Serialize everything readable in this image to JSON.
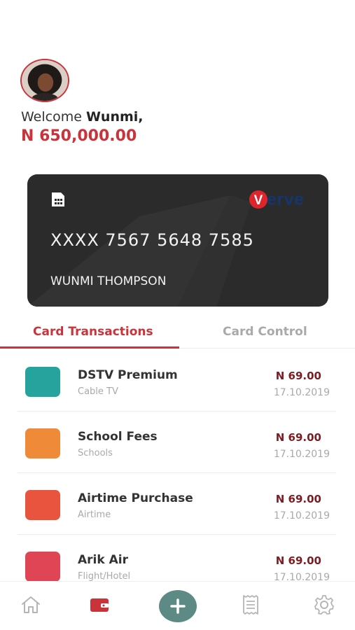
{
  "profile": {
    "avatar_icon": "user-avatar-photo",
    "welcome_prefix": "Welcome",
    "user_name": "Wunmi,",
    "balance": "N 650,000.00"
  },
  "card": {
    "chip_icon": "sim-chip-icon",
    "brand_mark": "V",
    "brand_text": "erve",
    "number": "XXXX 7567 5648 7585",
    "holder": "WUNMI THOMPSON"
  },
  "tabs": {
    "active": "Card Transactions",
    "inactive": "Card Control"
  },
  "transactions": [
    {
      "title": "DSTV Premium",
      "category": "Cable TV",
      "amount": "N 69.00",
      "date": "17.10.2019",
      "color": "#27a39d"
    },
    {
      "title": "School Fees",
      "category": "Schools",
      "amount": "N 69.00",
      "date": "17.10.2019",
      "color": "#ef8a38"
    },
    {
      "title": "Airtime Purchase",
      "category": "Airtime",
      "amount": "N 69.00",
      "date": "17.10.2019",
      "color": "#e8543d"
    },
    {
      "title": "Arik Air",
      "category": "Flight/Hotel",
      "amount": "N 69.00",
      "date": "17.10.2019",
      "color": "#e04555"
    }
  ],
  "nav": {
    "items": [
      "home-icon",
      "wallet-icon",
      "plus-icon",
      "receipt-icon",
      "settings-icon"
    ],
    "active": "wallet-icon"
  },
  "colors": {
    "accent": "#c9343b",
    "amount": "#7d1c23",
    "card_bg": "#2b2b2b",
    "fab": "#5e8a86"
  }
}
